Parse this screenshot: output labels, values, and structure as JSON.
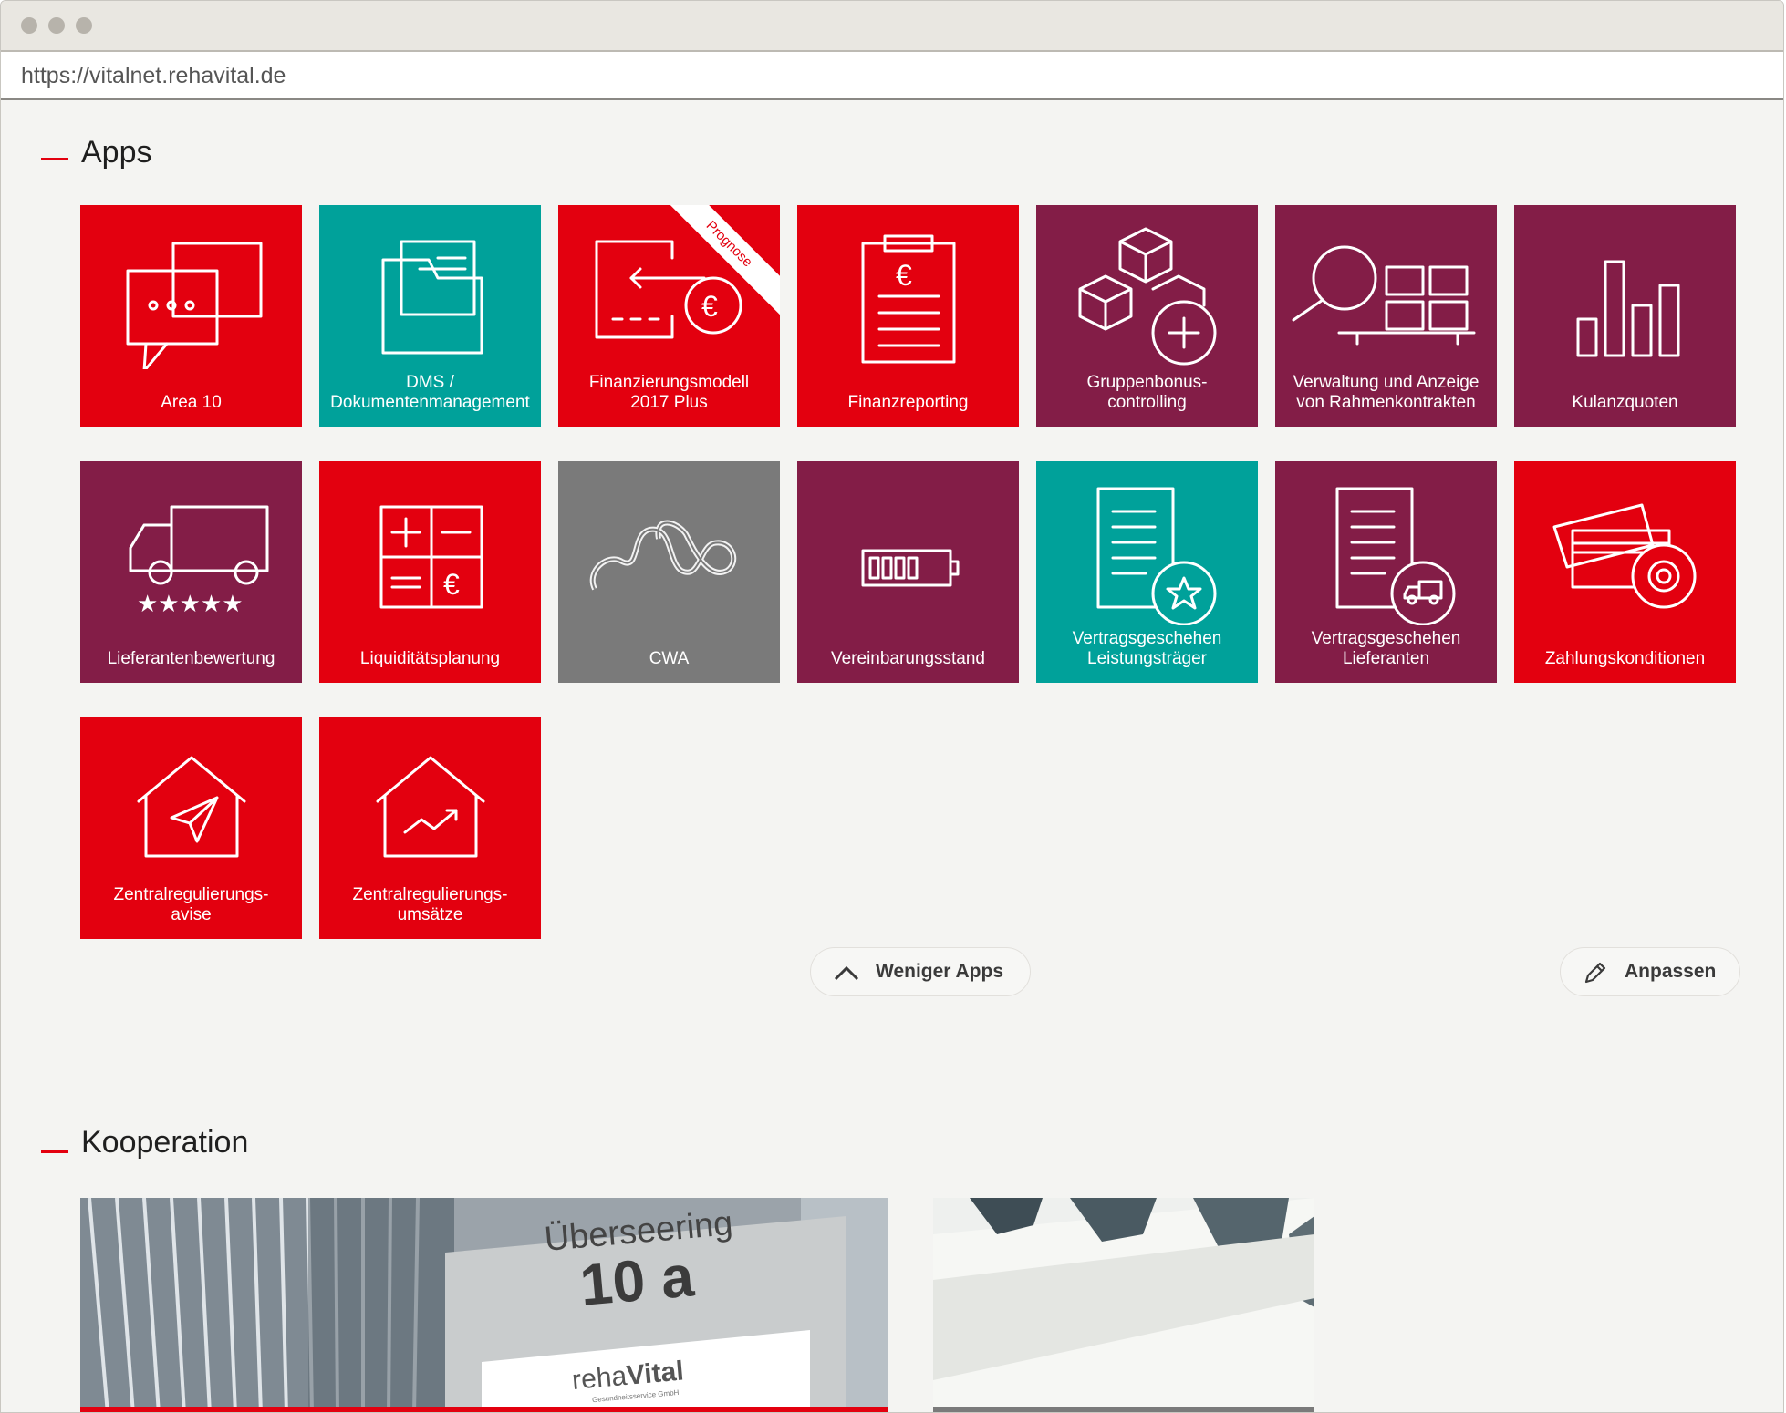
{
  "browser": {
    "url": "https://vitalnet.rehavital.de"
  },
  "colors": {
    "red": "#e3000f",
    "teal": "#00a19a",
    "plum": "#831d47",
    "gray": "#7a7a7a"
  },
  "apps_section": {
    "title": "Apps",
    "tiles": [
      {
        "label": "Area 10",
        "color": "red",
        "icon": "chat-bubbles-icon"
      },
      {
        "label": "DMS /\nDokumentenmanagement",
        "color": "teal",
        "icon": "document-folder-icon"
      },
      {
        "label": "Finanzierungsmodell\n2017 Plus",
        "color": "red",
        "icon": "money-transfer-icon",
        "ribbon": "Prognose"
      },
      {
        "label": "Finanzreporting",
        "color": "red",
        "icon": "clipboard-euro-icon"
      },
      {
        "label": "Gruppenbonus-\ncontrolling",
        "color": "plum",
        "icon": "cubes-plus-icon"
      },
      {
        "label": "Verwaltung und Anzeige\nvon Rahmenkontrakten",
        "color": "plum",
        "icon": "magnifier-shelf-icon"
      },
      {
        "label": "Kulanzquoten",
        "color": "plum",
        "icon": "bar-chart-icon"
      },
      {
        "label": "Lieferantenbewertung",
        "color": "plum",
        "icon": "truck-stars-icon"
      },
      {
        "label": "Liquiditätsplanung",
        "color": "red",
        "icon": "calculator-euro-icon"
      },
      {
        "label": "CWA",
        "color": "gray",
        "icon": "wave-icon"
      },
      {
        "label": "Vereinbarungsstand",
        "color": "plum",
        "icon": "battery-icon"
      },
      {
        "label": "Vertragsgeschehen\nLeistungsträger",
        "color": "teal",
        "icon": "document-star-icon"
      },
      {
        "label": "Vertragsgeschehen\nLieferanten",
        "color": "plum",
        "icon": "document-truck-icon"
      },
      {
        "label": "Zahlungskonditionen",
        "color": "red",
        "icon": "cards-gear-icon"
      },
      {
        "label": "Zentralregulierungs-\navise",
        "color": "red",
        "icon": "house-send-icon"
      },
      {
        "label": "Zentralregulierungs-\numsätze",
        "color": "red",
        "icon": "house-chart-icon"
      }
    ],
    "less_apps_label": "Weniger Apps",
    "customize_label": "Anpassen"
  },
  "kooperation_section": {
    "title": "Kooperation",
    "sign": {
      "street": "Überseering",
      "number": "10 a",
      "brand_light": "reha",
      "brand_bold": "Vital",
      "brand_sub": "Gesundheitsservice GmbH"
    }
  }
}
